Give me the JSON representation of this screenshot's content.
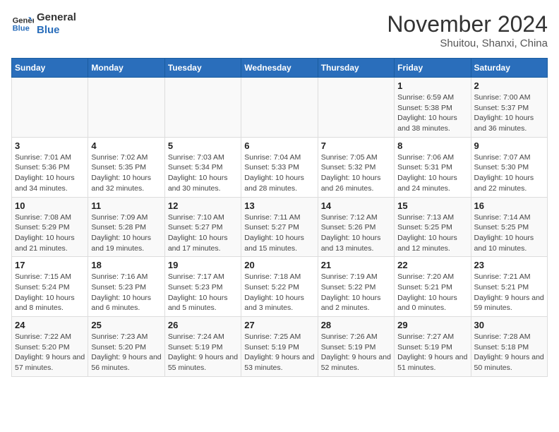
{
  "header": {
    "logo_line1": "General",
    "logo_line2": "Blue",
    "month": "November 2024",
    "location": "Shuitou, Shanxi, China"
  },
  "weekdays": [
    "Sunday",
    "Monday",
    "Tuesday",
    "Wednesday",
    "Thursday",
    "Friday",
    "Saturday"
  ],
  "weeks": [
    [
      {
        "day": "",
        "info": ""
      },
      {
        "day": "",
        "info": ""
      },
      {
        "day": "",
        "info": ""
      },
      {
        "day": "",
        "info": ""
      },
      {
        "day": "",
        "info": ""
      },
      {
        "day": "1",
        "info": "Sunrise: 6:59 AM\nSunset: 5:38 PM\nDaylight: 10 hours and 38 minutes."
      },
      {
        "day": "2",
        "info": "Sunrise: 7:00 AM\nSunset: 5:37 PM\nDaylight: 10 hours and 36 minutes."
      }
    ],
    [
      {
        "day": "3",
        "info": "Sunrise: 7:01 AM\nSunset: 5:36 PM\nDaylight: 10 hours and 34 minutes."
      },
      {
        "day": "4",
        "info": "Sunrise: 7:02 AM\nSunset: 5:35 PM\nDaylight: 10 hours and 32 minutes."
      },
      {
        "day": "5",
        "info": "Sunrise: 7:03 AM\nSunset: 5:34 PM\nDaylight: 10 hours and 30 minutes."
      },
      {
        "day": "6",
        "info": "Sunrise: 7:04 AM\nSunset: 5:33 PM\nDaylight: 10 hours and 28 minutes."
      },
      {
        "day": "7",
        "info": "Sunrise: 7:05 AM\nSunset: 5:32 PM\nDaylight: 10 hours and 26 minutes."
      },
      {
        "day": "8",
        "info": "Sunrise: 7:06 AM\nSunset: 5:31 PM\nDaylight: 10 hours and 24 minutes."
      },
      {
        "day": "9",
        "info": "Sunrise: 7:07 AM\nSunset: 5:30 PM\nDaylight: 10 hours and 22 minutes."
      }
    ],
    [
      {
        "day": "10",
        "info": "Sunrise: 7:08 AM\nSunset: 5:29 PM\nDaylight: 10 hours and 21 minutes."
      },
      {
        "day": "11",
        "info": "Sunrise: 7:09 AM\nSunset: 5:28 PM\nDaylight: 10 hours and 19 minutes."
      },
      {
        "day": "12",
        "info": "Sunrise: 7:10 AM\nSunset: 5:27 PM\nDaylight: 10 hours and 17 minutes."
      },
      {
        "day": "13",
        "info": "Sunrise: 7:11 AM\nSunset: 5:27 PM\nDaylight: 10 hours and 15 minutes."
      },
      {
        "day": "14",
        "info": "Sunrise: 7:12 AM\nSunset: 5:26 PM\nDaylight: 10 hours and 13 minutes."
      },
      {
        "day": "15",
        "info": "Sunrise: 7:13 AM\nSunset: 5:25 PM\nDaylight: 10 hours and 12 minutes."
      },
      {
        "day": "16",
        "info": "Sunrise: 7:14 AM\nSunset: 5:25 PM\nDaylight: 10 hours and 10 minutes."
      }
    ],
    [
      {
        "day": "17",
        "info": "Sunrise: 7:15 AM\nSunset: 5:24 PM\nDaylight: 10 hours and 8 minutes."
      },
      {
        "day": "18",
        "info": "Sunrise: 7:16 AM\nSunset: 5:23 PM\nDaylight: 10 hours and 6 minutes."
      },
      {
        "day": "19",
        "info": "Sunrise: 7:17 AM\nSunset: 5:23 PM\nDaylight: 10 hours and 5 minutes."
      },
      {
        "day": "20",
        "info": "Sunrise: 7:18 AM\nSunset: 5:22 PM\nDaylight: 10 hours and 3 minutes."
      },
      {
        "day": "21",
        "info": "Sunrise: 7:19 AM\nSunset: 5:22 PM\nDaylight: 10 hours and 2 minutes."
      },
      {
        "day": "22",
        "info": "Sunrise: 7:20 AM\nSunset: 5:21 PM\nDaylight: 10 hours and 0 minutes."
      },
      {
        "day": "23",
        "info": "Sunrise: 7:21 AM\nSunset: 5:21 PM\nDaylight: 9 hours and 59 minutes."
      }
    ],
    [
      {
        "day": "24",
        "info": "Sunrise: 7:22 AM\nSunset: 5:20 PM\nDaylight: 9 hours and 57 minutes."
      },
      {
        "day": "25",
        "info": "Sunrise: 7:23 AM\nSunset: 5:20 PM\nDaylight: 9 hours and 56 minutes."
      },
      {
        "day": "26",
        "info": "Sunrise: 7:24 AM\nSunset: 5:19 PM\nDaylight: 9 hours and 55 minutes."
      },
      {
        "day": "27",
        "info": "Sunrise: 7:25 AM\nSunset: 5:19 PM\nDaylight: 9 hours and 53 minutes."
      },
      {
        "day": "28",
        "info": "Sunrise: 7:26 AM\nSunset: 5:19 PM\nDaylight: 9 hours and 52 minutes."
      },
      {
        "day": "29",
        "info": "Sunrise: 7:27 AM\nSunset: 5:19 PM\nDaylight: 9 hours and 51 minutes."
      },
      {
        "day": "30",
        "info": "Sunrise: 7:28 AM\nSunset: 5:18 PM\nDaylight: 9 hours and 50 minutes."
      }
    ]
  ]
}
